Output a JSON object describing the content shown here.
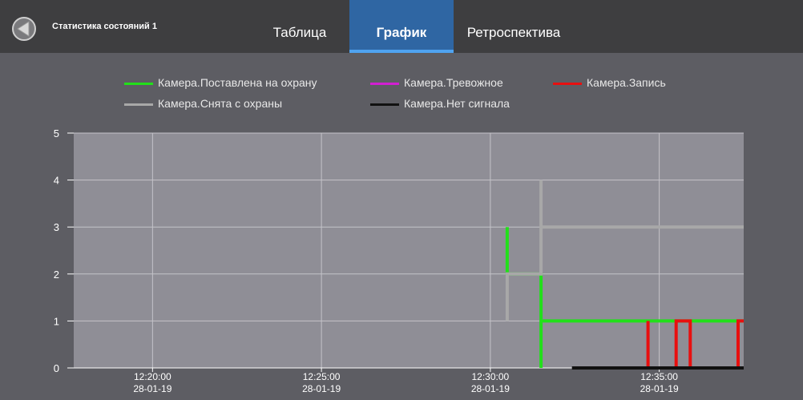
{
  "header": {
    "title": "Статистика состояний 1",
    "tabs": [
      {
        "label": "Таблица",
        "active": false
      },
      {
        "label": "График",
        "active": true
      },
      {
        "label": "Ретроспектива",
        "active": false
      }
    ]
  },
  "colors": {
    "header_bg": "#3e3e40",
    "active_tab": "#2f66a3",
    "plot_bg": "#8f8e96",
    "page_bg": "#5d5d63"
  },
  "legend": [
    {
      "label": "Камера.Поставлена на охрану",
      "color": "#22e01a"
    },
    {
      "label": "Камера.Тревожное",
      "color": "#d21fd2"
    },
    {
      "label": "Камера.Запись",
      "color": "#e80f0f"
    },
    {
      "label": "Камера.Снята с охраны",
      "color": "#a8a8a8"
    },
    {
      "label": "Камера.Нет сигнала",
      "color": "#111111"
    }
  ],
  "chart_data": {
    "type": "line",
    "step": true,
    "grid": true,
    "legend_position": "top",
    "ylim": [
      0,
      5
    ],
    "yticks": [
      "0",
      "1",
      "2",
      "3",
      "4",
      "5"
    ],
    "xlim": [
      "12:17:40",
      "12:37:30"
    ],
    "xticks": [
      {
        "time": "12:20:00",
        "date": "28-01-19"
      },
      {
        "time": "12:25:00",
        "date": "28-01-19"
      },
      {
        "time": "12:30:00",
        "date": "28-01-19"
      },
      {
        "time": "12:35:00",
        "date": "28-01-19"
      }
    ],
    "series": [
      {
        "name": "Камера.Поставлена на охрану",
        "color": "#22e01a",
        "points": [
          [
            "12:30:30",
            3
          ],
          [
            "12:30:30",
            2
          ],
          [
            "12:31:30",
            2
          ],
          [
            "12:31:30",
            0
          ],
          [
            "12:31:30",
            1
          ],
          [
            "12:37:30",
            1
          ]
        ]
      },
      {
        "name": "Камера.Снята с охраны",
        "color": "#a8a8a8",
        "points": [
          [
            "12:30:30",
            1
          ],
          [
            "12:30:30",
            2
          ],
          [
            "12:31:30",
            2
          ],
          [
            "12:31:30",
            4
          ],
          [
            "12:31:30",
            3
          ],
          [
            "12:37:30",
            3
          ]
        ]
      },
      {
        "name": "Камера.Запись",
        "color": "#e80f0f",
        "points": [
          [
            "12:34:40",
            1
          ],
          [
            "12:34:40",
            0
          ],
          [
            "12:35:30",
            0
          ],
          [
            "12:35:30",
            1
          ],
          [
            "12:35:55",
            1
          ],
          [
            "12:35:55",
            0
          ],
          [
            "12:37:20",
            0
          ],
          [
            "12:37:20",
            1
          ],
          [
            "12:37:30",
            1
          ]
        ]
      },
      {
        "name": "Камера.Нет сигнала",
        "color": "#111111",
        "points": [
          [
            "12:32:25",
            0
          ],
          [
            "12:37:30",
            0
          ]
        ]
      },
      {
        "name": "Камера.Тревожное",
        "color": "#d21fd2",
        "points": []
      }
    ]
  }
}
